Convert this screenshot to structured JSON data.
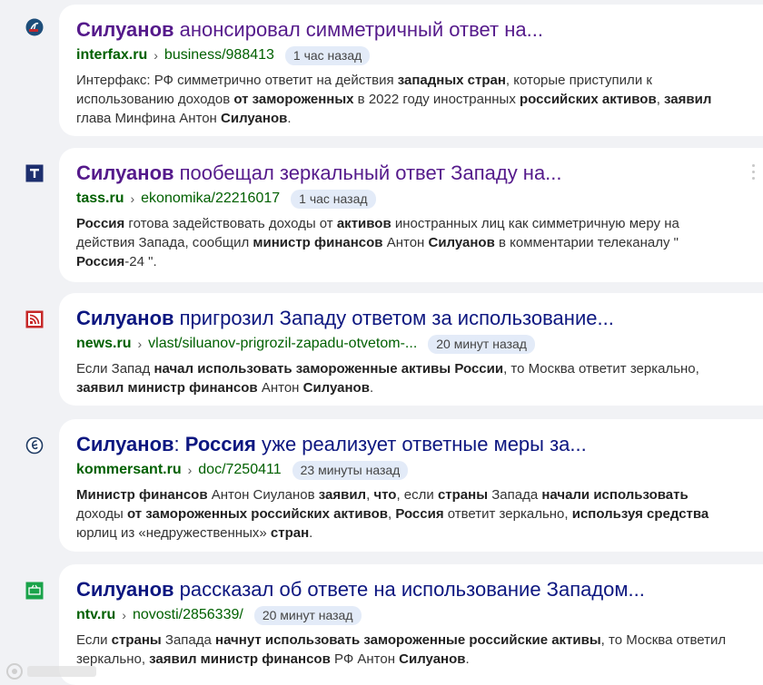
{
  "results": [
    {
      "favicon": "interfax-icon",
      "title_parts": [
        {
          "b": true,
          "t": "Силуанов"
        },
        {
          "b": false,
          "t": " анонсировал симметричный ответ на..."
        }
      ],
      "visited": true,
      "domain": "interfax.ru",
      "path": "business/988413",
      "time": "1 час назад",
      "snippet_parts": [
        {
          "b": false,
          "t": "Интерфакс: РФ симметрично ответит на действия "
        },
        {
          "b": true,
          "t": "западных стран"
        },
        {
          "b": false,
          "t": ", которые приступили к использованию доходов "
        },
        {
          "b": true,
          "t": "от замороженных"
        },
        {
          "b": false,
          "t": " в 2022 году иностранных "
        },
        {
          "b": true,
          "t": "российских активов"
        },
        {
          "b": false,
          "t": ", "
        },
        {
          "b": true,
          "t": "заявил"
        },
        {
          "b": false,
          "t": " глава Минфина Антон "
        },
        {
          "b": true,
          "t": "Силуанов"
        },
        {
          "b": false,
          "t": "."
        }
      ]
    },
    {
      "favicon": "tass-icon",
      "title_parts": [
        {
          "b": true,
          "t": "Силуанов"
        },
        {
          "b": false,
          "t": " пообещал зеркальный ответ Западу на..."
        }
      ],
      "visited": true,
      "domain": "tass.ru",
      "path": "ekonomika/22216017",
      "time": "1 час назад",
      "snippet_parts": [
        {
          "b": true,
          "t": "Россия"
        },
        {
          "b": false,
          "t": " готова задействовать доходы от "
        },
        {
          "b": true,
          "t": "активов"
        },
        {
          "b": false,
          "t": " иностранных лиц как симметричную меру на действия Запада, сообщил "
        },
        {
          "b": true,
          "t": "министр финансов"
        },
        {
          "b": false,
          "t": " Антон "
        },
        {
          "b": true,
          "t": "Силуанов"
        },
        {
          "b": false,
          "t": " в комментарии телеканалу \" "
        },
        {
          "b": true,
          "t": "Россия"
        },
        {
          "b": false,
          "t": "-24 \"."
        }
      ]
    },
    {
      "favicon": "news-rss-icon",
      "title_parts": [
        {
          "b": true,
          "t": "Силуанов"
        },
        {
          "b": false,
          "t": " пригрозил Западу ответом за использование..."
        }
      ],
      "visited": false,
      "domain": "news.ru",
      "path": "vlast/siluanov-prigrozil-zapadu-otvetom-...",
      "time": "20 минут назад",
      "snippet_parts": [
        {
          "b": false,
          "t": "Если Запад "
        },
        {
          "b": true,
          "t": "начал использовать замороженные активы России"
        },
        {
          "b": false,
          "t": ", то Москва ответит зеркально, "
        },
        {
          "b": true,
          "t": "заявил министр финансов"
        },
        {
          "b": false,
          "t": " Антон "
        },
        {
          "b": true,
          "t": "Силуанов"
        },
        {
          "b": false,
          "t": "."
        }
      ]
    },
    {
      "favicon": "kommersant-icon",
      "title_parts": [
        {
          "b": true,
          "t": "Силуанов"
        },
        {
          "b": false,
          "t": ": "
        },
        {
          "b": true,
          "t": "Россия"
        },
        {
          "b": false,
          "t": " уже реализует ответные меры за..."
        }
      ],
      "visited": false,
      "domain": "kommersant.ru",
      "path": "doc/7250411",
      "time": "23 минуты назад",
      "snippet_parts": [
        {
          "b": true,
          "t": "Министр финансов"
        },
        {
          "b": false,
          "t": " Антон Сиуланов "
        },
        {
          "b": true,
          "t": "заявил"
        },
        {
          "b": false,
          "t": ", "
        },
        {
          "b": true,
          "t": "что"
        },
        {
          "b": false,
          "t": ", если "
        },
        {
          "b": true,
          "t": "страны"
        },
        {
          "b": false,
          "t": " Запада "
        },
        {
          "b": true,
          "t": "начали использовать"
        },
        {
          "b": false,
          "t": " доходы "
        },
        {
          "b": true,
          "t": "от замороженных российских активов"
        },
        {
          "b": false,
          "t": ", "
        },
        {
          "b": true,
          "t": "Россия"
        },
        {
          "b": false,
          "t": " ответит зеркально, "
        },
        {
          "b": true,
          "t": "используя средства"
        },
        {
          "b": false,
          "t": " юрлиц из «недружественных» "
        },
        {
          "b": true,
          "t": "стран"
        },
        {
          "b": false,
          "t": "."
        }
      ]
    },
    {
      "favicon": "ntv-icon",
      "title_parts": [
        {
          "b": true,
          "t": "Силуанов"
        },
        {
          "b": false,
          "t": " рассказал об ответе на использование Западом..."
        }
      ],
      "visited": false,
      "domain": "ntv.ru",
      "path": "novosti/2856339/",
      "time": "20 минут назад",
      "snippet_parts": [
        {
          "b": false,
          "t": "Если "
        },
        {
          "b": true,
          "t": "страны"
        },
        {
          "b": false,
          "t": " Запада "
        },
        {
          "b": true,
          "t": "начнут использовать замороженные российские активы"
        },
        {
          "b": false,
          "t": ", то Москва ответил зеркально, "
        },
        {
          "b": true,
          "t": "заявил министр финансов"
        },
        {
          "b": false,
          "t": " РФ Антон "
        },
        {
          "b": true,
          "t": "Силуанов"
        },
        {
          "b": false,
          "t": "."
        }
      ]
    }
  ],
  "colors": {
    "visited_title": "#551a8b",
    "title": "#0d1780",
    "domain": "#006000",
    "badge_bg": "#e3ebf8"
  }
}
